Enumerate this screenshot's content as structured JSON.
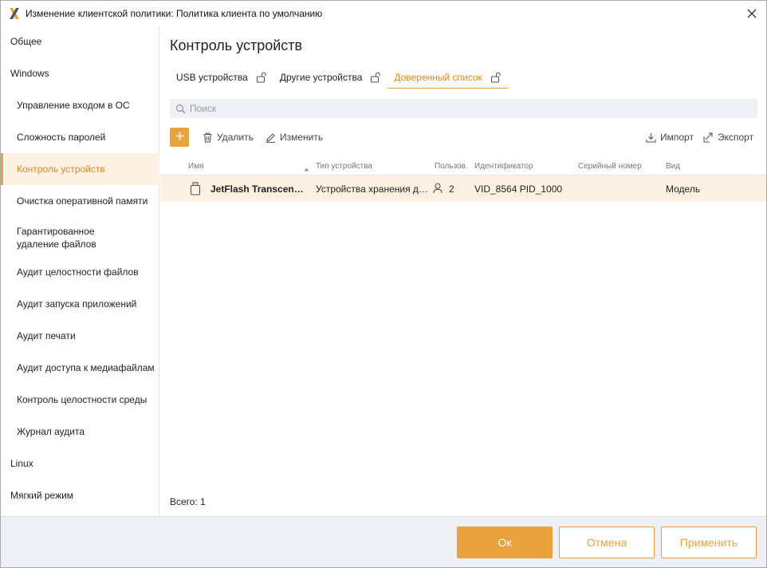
{
  "window": {
    "title": "Изменение клиентской политики: Политика клиента по умолчанию"
  },
  "colors": {
    "accent": "#e8a33d",
    "selected_bg": "#fdf1e3",
    "search_bg": "#eef0f5",
    "footer_bg": "#eef0f5"
  },
  "sidebar": {
    "items": [
      {
        "label": "Общее",
        "level": 0
      },
      {
        "label": "Windows",
        "level": 0
      },
      {
        "label": "Управление входом в ОС",
        "level": 1
      },
      {
        "label": "Сложность паролей",
        "level": 1
      },
      {
        "label": "Контроль устройств",
        "level": 1,
        "active": true
      },
      {
        "label": "Очистка оперативной памяти",
        "level": 1
      },
      {
        "label": "Гарантированное удаление файлов",
        "level": 1
      },
      {
        "label": "Аудит целостности файлов",
        "level": 1
      },
      {
        "label": "Аудит запуска приложений",
        "level": 1
      },
      {
        "label": "Аудит печати",
        "level": 1
      },
      {
        "label": "Аудит доступа к медиафайлам",
        "level": 1
      },
      {
        "label": "Контроль целостности среды",
        "level": 1
      },
      {
        "label": "Журнал аудита",
        "level": 1
      },
      {
        "label": "Linux",
        "level": 0
      },
      {
        "label": "Мягкий режим",
        "level": 0
      }
    ]
  },
  "main": {
    "title": "Контроль устройств",
    "tabs": [
      {
        "label": "USB устройства",
        "icon": "lock-icon"
      },
      {
        "label": "Другие устройства",
        "icon": "lock-icon"
      },
      {
        "label": "Доверенный список",
        "icon": "lock-icon",
        "active": true
      }
    ],
    "search": {
      "placeholder": "Поиск",
      "value": ""
    },
    "toolbar": {
      "add_icon": "plus-icon",
      "delete_label": "Удалить",
      "edit_label": "Изменить",
      "import_label": "Импорт",
      "export_label": "Экспорт"
    },
    "table": {
      "columns": [
        "Имя",
        "Тип устройства",
        "Пользов.",
        "Идентификатор",
        "Серийный номер",
        "Вид"
      ],
      "sort_column": "Имя",
      "rows": [
        {
          "icon": "usb-drive-icon",
          "name": "JetFlash Transcend 3...",
          "type": "Устройства хранения да...",
          "users": "2",
          "id": "VID_8564 PID_1000",
          "serial": "",
          "kind": "Модель"
        }
      ]
    },
    "total": "Всего: 1"
  },
  "footer": {
    "ok_label": "Ок",
    "cancel_label": "Отмена",
    "apply_label": "Применить"
  }
}
